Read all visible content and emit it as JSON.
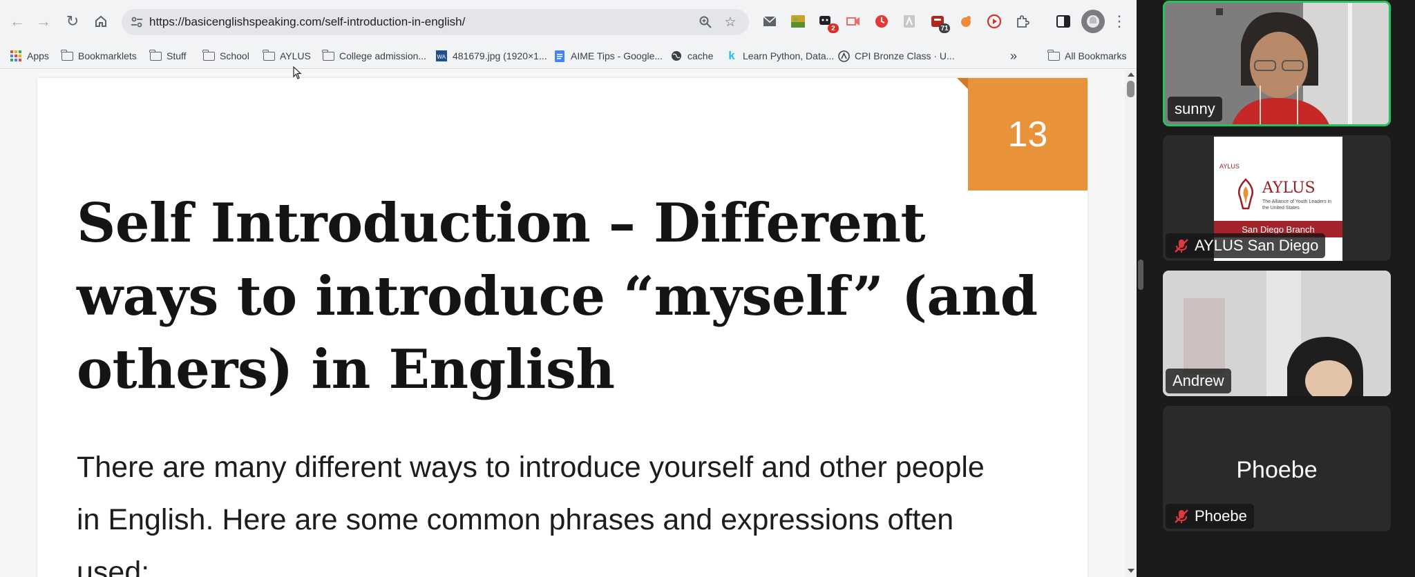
{
  "browser": {
    "url": "https://basicenglishspeaking.com/self-introduction-in-english/",
    "bookmarks": [
      {
        "label": "Apps",
        "icon": "apps-grid-icon"
      },
      {
        "label": "Bookmarklets",
        "icon": "folder-icon"
      },
      {
        "label": "Stuff",
        "icon": "folder-icon"
      },
      {
        "label": "School",
        "icon": "folder-icon"
      },
      {
        "label": "AYLUS",
        "icon": "folder-icon"
      },
      {
        "label": "College admission...",
        "icon": "folder-icon"
      },
      {
        "label": "481679.jpg (1920×1...",
        "icon": "image-favicon-icon"
      },
      {
        "label": "AIME Tips - Google...",
        "icon": "docs-favicon-icon"
      },
      {
        "label": "cache",
        "icon": "globe-icon"
      },
      {
        "label": "Learn Python, Data...",
        "icon": "k-favicon-icon"
      },
      {
        "label": "CPI Bronze Class · U...",
        "icon": "a-favicon-icon"
      }
    ],
    "more_label": "»",
    "all_bookmarks": "All Bookmarks",
    "extension_badges": {
      "ext1": "2",
      "ext2": "71"
    }
  },
  "page": {
    "badge_number": "13",
    "title": "Self Introduction – Different ways to introduce “myself” (and others) in English",
    "body": "There are many different ways to introduce yourself and other people in English. Here are some common phrases and expressions often used:"
  },
  "meeting": {
    "participants": [
      {
        "name": "sunny",
        "muted": false,
        "active_speaker": true
      },
      {
        "name": "AYLUS San Diego",
        "muted": true,
        "active_speaker": false
      },
      {
        "name": "Andrew",
        "muted": false,
        "active_speaker": false
      },
      {
        "name": "Phoebe",
        "muted": true,
        "active_speaker": false
      }
    ],
    "aylus_logo": {
      "small": "AYLUS",
      "brand": "AYLUS",
      "tagline": "The Alliance of Youth Leaders in the United States",
      "band": "San Diego Branch"
    },
    "colors": {
      "active_border": "#22c55e",
      "mute_red": "#e0383e",
      "badge_orange": "#e8923a"
    }
  }
}
